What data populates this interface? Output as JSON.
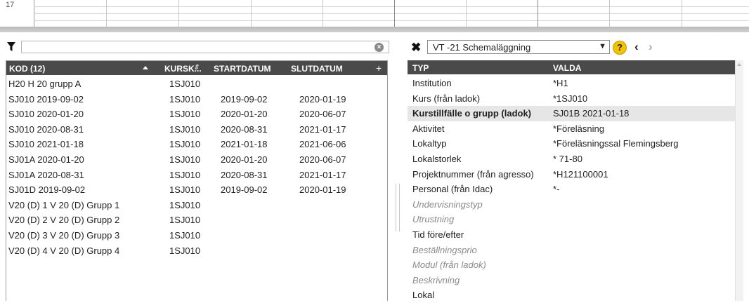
{
  "top_strip": {
    "row_number": "17"
  },
  "left_panel": {
    "filter_value": "",
    "columns": {
      "kod": "KOD (12)",
      "kurs": "KURSK...",
      "startdatum": "STARTDATUM",
      "slutdatum": "SLUTDATUM",
      "add": "+"
    },
    "rows": [
      {
        "kod": "H20 H 20 grupp A",
        "kurs": "1SJ010",
        "start": "",
        "slut": ""
      },
      {
        "kod": "SJ010 2019-09-02",
        "kurs": "1SJ010",
        "start": "2019-09-02",
        "slut": "2020-01-19"
      },
      {
        "kod": "SJ010 2020-01-20",
        "kurs": "1SJ010",
        "start": "2020-01-20",
        "slut": "2020-06-07"
      },
      {
        "kod": "SJ010 2020-08-31",
        "kurs": "1SJ010",
        "start": "2020-08-31",
        "slut": "2021-01-17"
      },
      {
        "kod": "SJ010 2021-01-18",
        "kurs": "1SJ010",
        "start": "2021-01-18",
        "slut": "2021-06-06"
      },
      {
        "kod": "SJ01A 2020-01-20",
        "kurs": "1SJ010",
        "start": "2020-01-20",
        "slut": "2020-06-07"
      },
      {
        "kod": "SJ01A 2020-08-31",
        "kurs": "1SJ010",
        "start": "2020-08-31",
        "slut": "2021-01-17"
      },
      {
        "kod": "SJ01D 2019-09-02",
        "kurs": "1SJ010",
        "start": "2019-09-02",
        "slut": "2020-01-19"
      },
      {
        "kod": "V20 (D) 1 V 20 (D) Grupp 1",
        "kurs": "1SJ010",
        "start": "",
        "slut": ""
      },
      {
        "kod": "V20 (D) 2 V 20 (D) Grupp 2",
        "kurs": "1SJ010",
        "start": "",
        "slut": ""
      },
      {
        "kod": "V20 (D) 3 V 20 (D) Grupp 3",
        "kurs": "1SJ010",
        "start": "",
        "slut": ""
      },
      {
        "kod": "V20 (D) 4 V 20 (D) Grupp 4",
        "kurs": "1SJ010",
        "start": "",
        "slut": ""
      }
    ]
  },
  "right_panel": {
    "selected_view": "VT -21 Schemaläggning",
    "help_label": "?",
    "columns": {
      "typ": "TYP",
      "valda": "VALDA"
    },
    "rows": [
      {
        "key": "Institution",
        "value": "*H1"
      },
      {
        "key": "Kurs (från ladok)",
        "value": "*1SJ010"
      },
      {
        "key": "Kurstillfälle o grupp (ladok)",
        "value": "SJ01B 2021-01-18"
      },
      {
        "key": "Aktivitet",
        "value": "*Föreläsning"
      },
      {
        "key": "Lokaltyp",
        "value": "*Föreläsningssal Flemingsberg"
      },
      {
        "key": "Lokalstorlek",
        "value": "* 71-80"
      },
      {
        "key": "Projektnummer (från agresso)",
        "value": "*H121100001"
      },
      {
        "key": "Personal (från Idac)",
        "value": "*-"
      },
      {
        "key": "Undervisningstyp",
        "value": ""
      },
      {
        "key": "Utrustning",
        "value": ""
      },
      {
        "key": "Tid före/efter",
        "value": ""
      },
      {
        "key": "Beställningsprio",
        "value": ""
      },
      {
        "key": "Modul (från ladok)",
        "value": ""
      },
      {
        "key": "Beskrivning",
        "value": ""
      },
      {
        "key": "Lokal",
        "value": ""
      }
    ]
  }
}
